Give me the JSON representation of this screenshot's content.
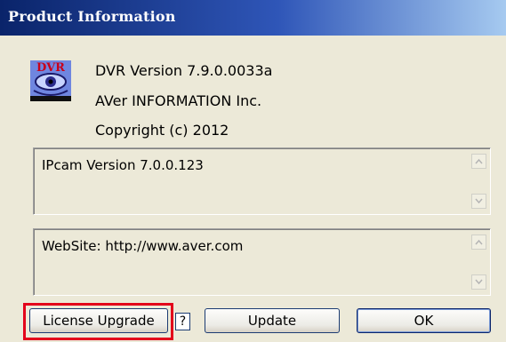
{
  "window": {
    "title": "Product Information"
  },
  "logo": {
    "text": "DVR",
    "icon": "eye-logo-icon"
  },
  "product": {
    "version": "DVR Version 7.9.0.0033a",
    "company": "AVer INFORMATION Inc.",
    "copyright": "Copyright (c) 2012"
  },
  "ipcam_box": {
    "text": "IPcam Version 7.0.0.123"
  },
  "website_box": {
    "text": "WebSite: http://www.aver.com"
  },
  "buttons": {
    "license": "License Upgrade",
    "help": "?",
    "update": "Update",
    "ok": "OK"
  },
  "colors": {
    "title_bar": "#0a246a",
    "dialog_bg": "#ece9d8",
    "highlight": "#e3001b"
  }
}
